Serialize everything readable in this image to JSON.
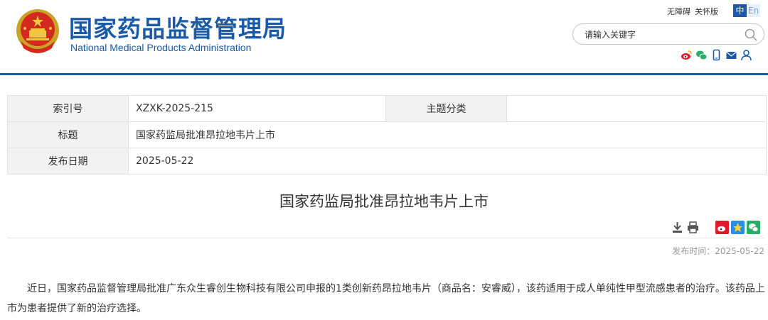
{
  "header": {
    "title_cn": "国家药品监督管理局",
    "title_en": "National Medical Products Administration",
    "top_links": [
      "无障碍",
      "关怀版"
    ],
    "lang": {
      "zh": "中",
      "en": "En"
    },
    "search_placeholder": "请输入关键字",
    "accent_color": "#1a5aa8"
  },
  "info": {
    "index_label": "索引号",
    "index_value": "XZXK-2025-215",
    "category_label": "主题分类",
    "category_value": "",
    "title_label": "标题",
    "title_value": "国家药监局批准昂拉地韦片上市",
    "date_label": "发布日期",
    "date_value": "2025-05-22"
  },
  "article": {
    "title": "国家药监局批准昂拉地韦片上市",
    "pubtime": "发布时间：2025-05-22",
    "body": "近日，国家药品监督管理局批准广东众生睿创生物科技有限公司申报的1类创新药昂拉地韦片（商品名：安睿威），该药适用于成人单纯性甲型流感患者的治疗。该药品上市为患者提供了新的治疗选择。"
  }
}
